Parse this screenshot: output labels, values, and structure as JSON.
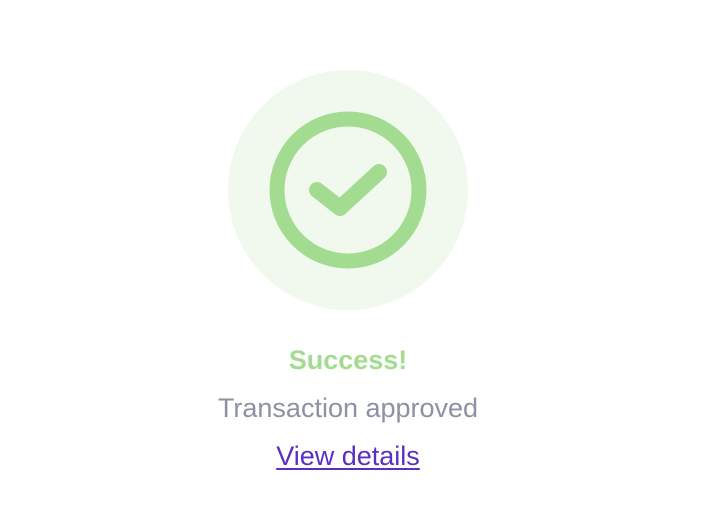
{
  "status": {
    "icon": "check-circle-icon",
    "title": "Success!",
    "message": "Transaction approved",
    "link_label": "View details"
  },
  "colors": {
    "success_light": "#f1f9ee",
    "success": "#a3dc91",
    "message_text": "#8a93a3",
    "link": "#5b2fc0",
    "background": "#ffffff"
  }
}
